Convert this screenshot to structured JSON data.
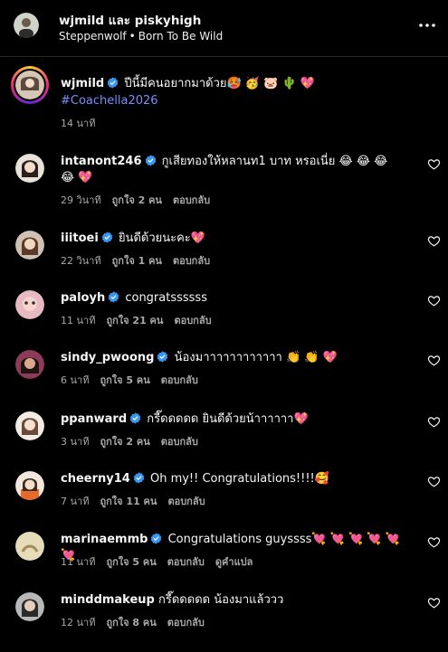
{
  "header": {
    "title": "wjmild และ piskyhigh",
    "song_artist": "Steppenwolf",
    "song_separator": "•",
    "song_title": "Born To Be Wild"
  },
  "caption": {
    "username": "wjmild",
    "text": "ปีนี้มีคนอยากมาด้วย🥵 🥳 🐷 🌵 💖",
    "hashtag": "#Coachella2026",
    "time": "14 นาที"
  },
  "actions": {
    "reply": "ตอบกลับ",
    "translate": "ดูคำแปล"
  },
  "comments": [
    {
      "username": "intanont246",
      "text": "กูเสียทองให้หลานท1 บาท หรอเนี่ย 😂 😂 😂 😂 💖",
      "time": "29 วินาที",
      "likes": "ถูกใจ 2 คน",
      "reply": "ตอบกลับ"
    },
    {
      "username": "iiitoei",
      "text": "ยินดีด้วยนะคะ💖",
      "time": "22 วินาที",
      "likes": "ถูกใจ 1 คน",
      "reply": "ตอบกลับ"
    },
    {
      "username": "paloyh",
      "text": "congratssssss",
      "time": "11 นาที",
      "likes": "ถูกใจ 21 คน",
      "reply": "ตอบกลับ"
    },
    {
      "username": "sindy_pwoong",
      "text": "น้องมาาาาาาาาาาาา 👏 👏 💖",
      "time": "6 นาที",
      "likes": "ถูกใจ 5 คน",
      "reply": "ตอบกลับ"
    },
    {
      "username": "ppanward",
      "text": "กรี๊ดดดดด ยินดีด้วยน้าาาาาา💖",
      "time": "3 นาที",
      "likes": "ถูกใจ 2 คน",
      "reply": "ตอบกลับ"
    },
    {
      "username": "cheerny14",
      "text": "Oh my!! Congratulations!!!!🥰",
      "time": "7 นาที",
      "likes": "ถูกใจ 11 คน",
      "reply": "ตอบกลับ"
    },
    {
      "username": "marinaemmb",
      "text": "Congratulations guyssss💘 💘 💘 💘 💘 💘",
      "time": "11 นาที",
      "likes": "ถูกใจ 5 คน",
      "reply": "ตอบกลับ",
      "translate": "ดูคำแปล"
    },
    {
      "username": "minddmakeup",
      "text": "กรี๊ดดดดด น้องมาแล้ววว",
      "time": "12 นาที",
      "likes": "ถูกใจ 8 คน",
      "reply": "ตอบกลับ"
    }
  ],
  "colors": {
    "background": "#000000",
    "verified": "#3897f0",
    "hashtag": "#7b8cff",
    "muted": "#a8a8a8"
  }
}
